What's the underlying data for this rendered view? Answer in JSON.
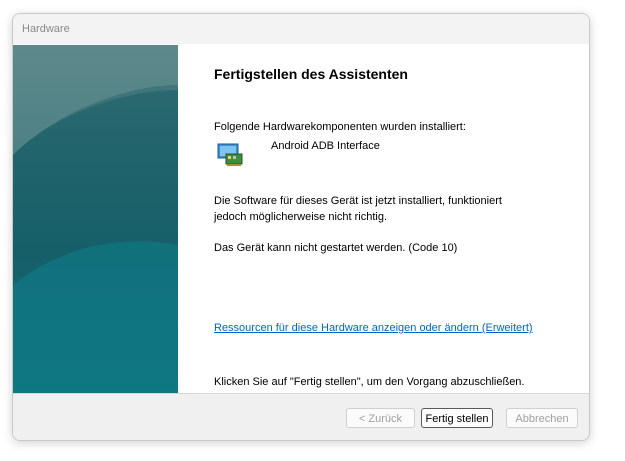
{
  "window": {
    "title": "Hardware"
  },
  "wizard": {
    "heading": "Fertigstellen des Assistenten",
    "installed_intro": "Folgende Hardwarekomponenten wurden installiert:",
    "device_name": "Android ADB Interface",
    "device_icon": "network-adapter-icon",
    "status_line1": "Die Software für dieses Gerät ist jetzt installiert, funktioniert",
    "status_line2": "jedoch möglicherweise nicht richtig.",
    "error_text": "Das Gerät kann nicht gestartet werden. (Code 10)",
    "resources_link": "Ressourcen für diese Hardware anzeigen oder ändern (Erweitert)",
    "finish_hint": "Klicken Sie auf \"Fertig stellen\", um den Vorgang abzuschließen."
  },
  "buttons": {
    "back": "< Zurück",
    "finish": "Fertig stellen",
    "cancel": "Abbrechen"
  },
  "colors": {
    "link": "#0066cc",
    "panel_top": "#4f7d80",
    "panel_bottom": "#0a7f8a"
  }
}
